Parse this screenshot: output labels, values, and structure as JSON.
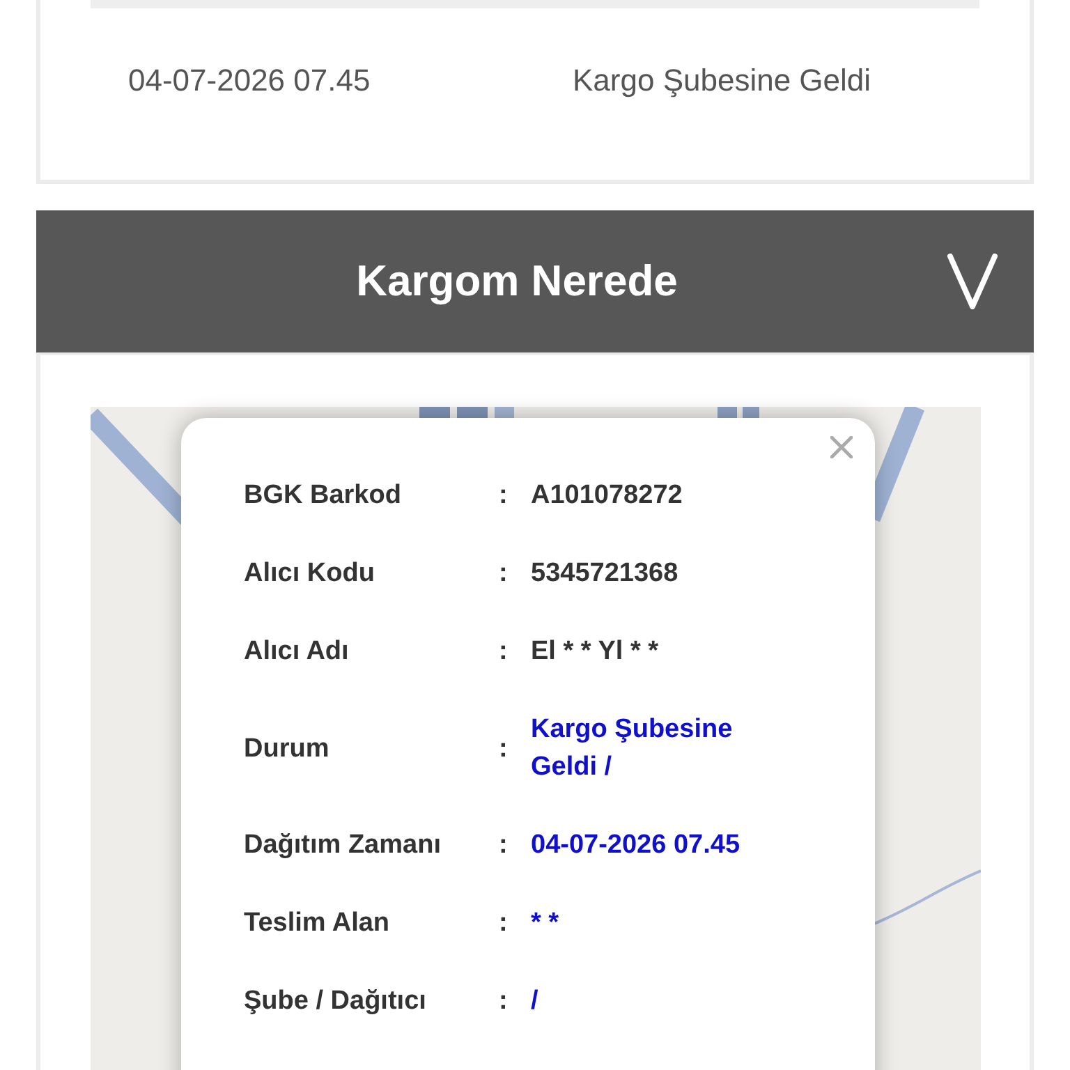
{
  "history": {
    "rows": [
      {
        "date": "04-07-2026 07.45",
        "status": "Kargo Şubesine Geldi"
      }
    ]
  },
  "tracking_section": {
    "title": "Kargom Nerede",
    "expanded": true,
    "popup": {
      "fields": [
        {
          "label": "BGK Barkod",
          "separator": ":",
          "value": "A101078272",
          "color": "#333333"
        },
        {
          "label": "Alıcı Kodu",
          "separator": ":",
          "value": "5345721368",
          "color": "#333333"
        },
        {
          "label": "Alıcı Adı",
          "separator": ":",
          "value": "El * * Yl * *",
          "color": "#333333"
        },
        {
          "label": "Durum",
          "separator": ":",
          "value": "Kargo Şubesine Geldi /",
          "color": "#0f0fcc"
        },
        {
          "label": "Dağıtım Zamanı",
          "separator": ":",
          "value": "04-07-2026 07.45",
          "color": "#0f0fcc"
        },
        {
          "label": "Teslim Alan",
          "separator": ":",
          "value": "* *",
          "color": "#0f0fcc"
        },
        {
          "label": "Şube / Dağıtıcı",
          "separator": ":",
          "value": "/",
          "color": "#0f0fcc"
        }
      ]
    }
  }
}
